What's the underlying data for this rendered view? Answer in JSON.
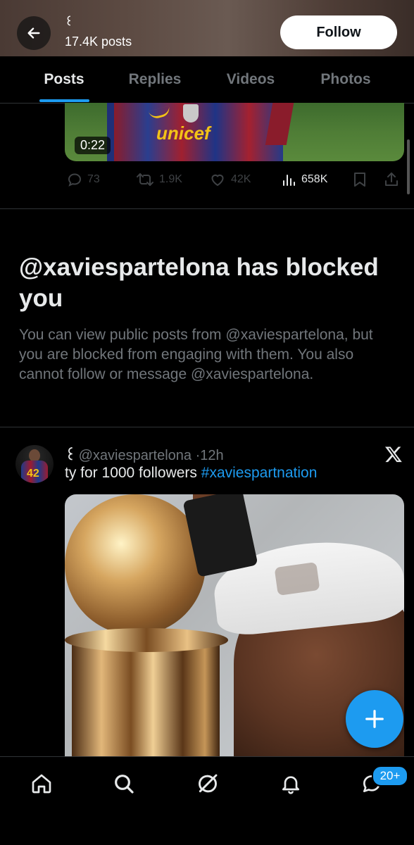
{
  "header": {
    "name": "꒰",
    "post_count": "17.4K posts",
    "follow_label": "Follow",
    "back_icon": "arrow-left-icon"
  },
  "tabs": [
    {
      "label": "Posts",
      "active": true
    },
    {
      "label": "Replies",
      "active": false
    },
    {
      "label": "Videos",
      "active": false
    },
    {
      "label": "Photos",
      "active": false
    }
  ],
  "previous_post": {
    "jersey_text": "unicef",
    "duration": "0:22",
    "replies": "73",
    "reposts": "1.9K",
    "likes": "42K",
    "views": "658K"
  },
  "blocked_notice": {
    "title": "@xaviespartelona has blocked you",
    "description": "You can view public posts from @xaviespartelona, but you are blocked from engaging with them. You also cannot follow or message @xaviespartelona."
  },
  "post": {
    "name_glyph": "꒰",
    "handle": "@xaviespartelona",
    "separator": "·",
    "time": "12h",
    "text": "ty for 1000 followers ",
    "hashtag": "#xaviespartnation",
    "avatar_number": "42"
  },
  "fab": {
    "icon": "plus-icon"
  },
  "bottom_nav": {
    "items": [
      "home-icon",
      "search-icon",
      "grok-icon",
      "notifications-icon",
      "messages-icon"
    ],
    "badge": "20+"
  },
  "colors": {
    "accent": "#1d9bf0",
    "background": "#000000",
    "text_primary": "#e7e9ea",
    "text_secondary": "#71767b",
    "divider": "#2f3336"
  }
}
